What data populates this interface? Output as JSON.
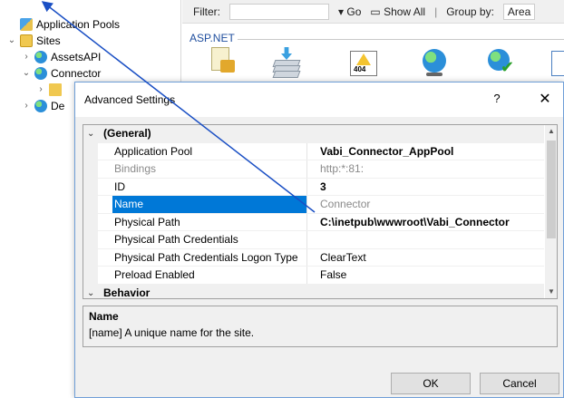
{
  "tree": {
    "items": [
      {
        "label": "Application Pools",
        "icon": "app-pools-icon"
      },
      {
        "label": "Sites",
        "icon": "sites-icon"
      },
      {
        "label": "AssetsAPI",
        "icon": "globe-icon"
      },
      {
        "label": "Connector",
        "icon": "globe-icon"
      },
      {
        "label": "",
        "icon": "folder-icon"
      },
      {
        "label": "De",
        "icon": "globe-icon"
      }
    ]
  },
  "filterbar": {
    "filter_label": "Filter:",
    "go_label": "Go",
    "show_all_label": "Show All",
    "group_by_label": "Group by:",
    "group_by_value": "Area"
  },
  "features": {
    "section_label": "ASP.NET",
    "error_icon_text": "404"
  },
  "dialog": {
    "title": "Advanced Settings",
    "help_label": "?",
    "close_label": "✕",
    "ok_label": "OK",
    "cancel_label": "Cancel",
    "rows": [
      {
        "name": "(General)",
        "value": ""
      },
      {
        "name": "Application Pool",
        "value": "Vabi_Connector_AppPool"
      },
      {
        "name": "Bindings",
        "value": "http:*:81:"
      },
      {
        "name": "ID",
        "value": "3"
      },
      {
        "name": "Name",
        "value": "Connector"
      },
      {
        "name": "Physical Path",
        "value": "C:\\inetpub\\wwwroot\\Vabi_Connector"
      },
      {
        "name": "Physical Path Credentials",
        "value": ""
      },
      {
        "name": "Physical Path Credentials Logon Type",
        "value": "ClearText"
      },
      {
        "name": "Preload Enabled",
        "value": "False"
      },
      {
        "name": "Behavior",
        "value": ""
      }
    ],
    "description": {
      "title": "Name",
      "text": "[name] A unique name for the site."
    }
  },
  "colors": {
    "selection": "#0078d7",
    "annotation_arrow": "#1a4fc4",
    "section_label": "#1f4e9e"
  }
}
